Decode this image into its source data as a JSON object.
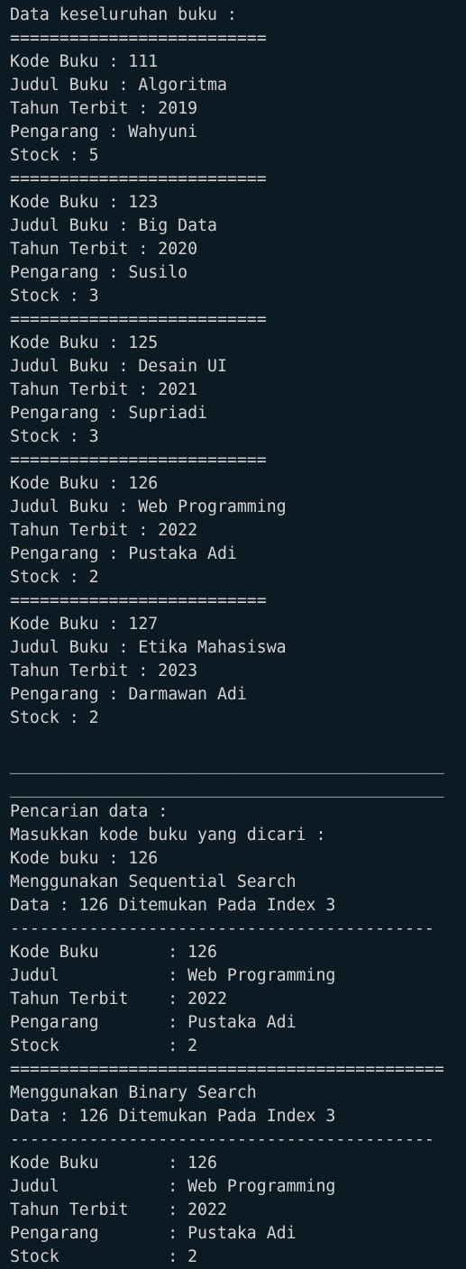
{
  "terminal": {
    "lines": [
      "Data keseluruhan buku :",
      "==========================",
      "Kode Buku : 111",
      "Judul Buku : Algoritma",
      "Tahun Terbit : 2019",
      "Pengarang : Wahyuni",
      "Stock : 5",
      "==========================",
      "Kode Buku : 123",
      "Judul Buku : Big Data",
      "Tahun Terbit : 2020",
      "Pengarang : Susilo",
      "Stock : 3",
      "==========================",
      "Kode Buku : 125",
      "Judul Buku : Desain UI",
      "Tahun Terbit : 2021",
      "Pengarang : Supriadi",
      "Stock : 3",
      "==========================",
      "Kode Buku : 126",
      "Judul Buku : Web Programming",
      "Tahun Terbit : 2022",
      "Pengarang : Pustaka Adi",
      "Stock : 2",
      "==========================",
      "Kode Buku : 127",
      "Judul Buku : Etika Mahasiswa",
      "Tahun Terbit : 2023",
      "Pengarang : Darmawan Adi",
      "Stock : 2",
      "",
      "____________________________________________",
      "____________________________________________",
      "Pencarian data :",
      "Masukkan kode buku yang dicari :",
      "Kode buku : 126",
      "Menggunakan Sequential Search",
      "Data : 126 Ditemukan Pada Index 3",
      "-------------------------------------------",
      "Kode Buku       : 126",
      "Judul           : Web Programming",
      "Tahun Terbit    : 2022",
      "Pengarang       : Pustaka Adi",
      "Stock           : 2",
      "============================================",
      "Menggunakan Binary Search",
      "Data : 126 Ditemukan Pada Index 3",
      "-------------------------------------------",
      "Kode Buku       : 126",
      "Judul           : Web Programming",
      "Tahun Terbit    : 2022",
      "Pengarang       : Pustaka Adi",
      "Stock           : 2"
    ]
  }
}
